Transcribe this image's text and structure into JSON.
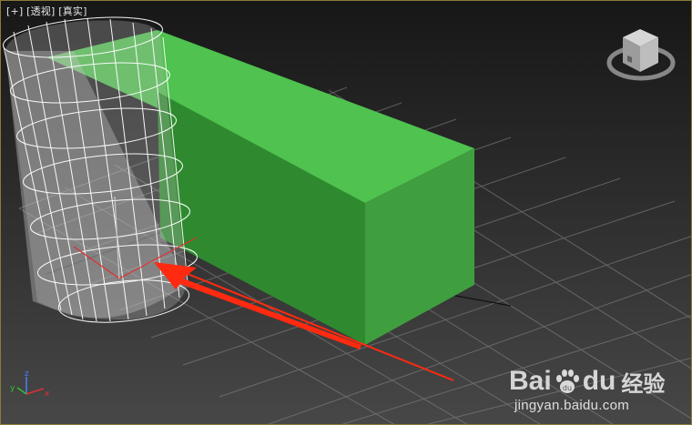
{
  "viewport": {
    "labels": [
      "[+]",
      "[透视]",
      "[真实]"
    ],
    "view_type": "perspective",
    "shading": "realistic"
  },
  "scene": {
    "grid_color": "#8c8c8c",
    "box_color": "#4fc24f",
    "cylinder_display": "wireframe-over-shaded",
    "annotation_arrow_color": "#ff2a10"
  },
  "nav": {
    "viewcube_icon": "viewcube-icon",
    "axis_tripod_icon": "axis-tripod-icon",
    "axis_x": "x",
    "axis_y": "y",
    "axis_z": "z"
  },
  "watermark": {
    "bai": "Bai",
    "du": "du",
    "jingyan": "经验",
    "url": "jingyan.baidu.com"
  }
}
